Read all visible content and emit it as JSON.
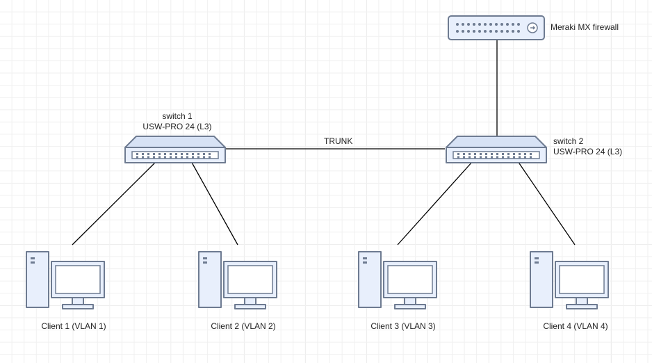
{
  "diagram": {
    "firewall": {
      "label": "Meraki MX firewall"
    },
    "switch1": {
      "line1": "switch 1",
      "line2": "USW-PRO 24 (L3)"
    },
    "switch2": {
      "line1": "switch 2",
      "line2": "USW-PRO 24 (L3)"
    },
    "link_trunk": "TRUNK",
    "client1": "Client 1 (VLAN 1)",
    "client2": "Client 2 (VLAN 2)",
    "client3": "Client 3 (VLAN 3)",
    "client4": "Client 4 (VLAN  4)"
  }
}
